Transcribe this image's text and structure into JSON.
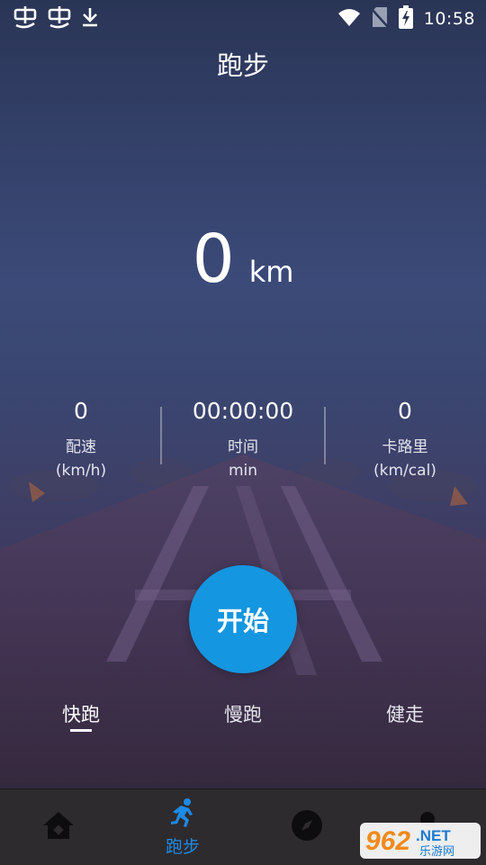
{
  "status_bar": {
    "time": "10:58",
    "left_icons": [
      "app-notification-icon",
      "app-notification-icon",
      "download-icon"
    ],
    "right_icons": [
      "wifi-icon",
      "no-sim-icon",
      "battery-charging-icon"
    ]
  },
  "header": {
    "title": "跑步"
  },
  "distance": {
    "value": "0",
    "unit": "km"
  },
  "stats": [
    {
      "value": "0",
      "label": "配速",
      "unit": "(km/h)"
    },
    {
      "value": "00:00:00",
      "label": "时间",
      "unit": "min"
    },
    {
      "value": "0",
      "label": "卡路里",
      "unit": "(km/cal)"
    }
  ],
  "start_button": {
    "label": "开始"
  },
  "modes": [
    {
      "label": "快跑",
      "active": true
    },
    {
      "label": "慢跑",
      "active": false
    },
    {
      "label": "健走",
      "active": false
    }
  ],
  "bottom_nav": {
    "items": [
      {
        "icon": "home-icon",
        "label": ""
      },
      {
        "icon": "runner-icon",
        "label": "跑步",
        "active": true
      },
      {
        "icon": "compass-icon",
        "label": ""
      },
      {
        "icon": "profile-icon",
        "label": ""
      }
    ],
    "active_color": "#1e8ae6"
  },
  "watermark": {
    "text_main": "962",
    "text_suffix": ".NET",
    "text_sub": "乐游网"
  },
  "colors": {
    "accent": "#1596e0",
    "nav_bg": "#2e2b2e"
  }
}
